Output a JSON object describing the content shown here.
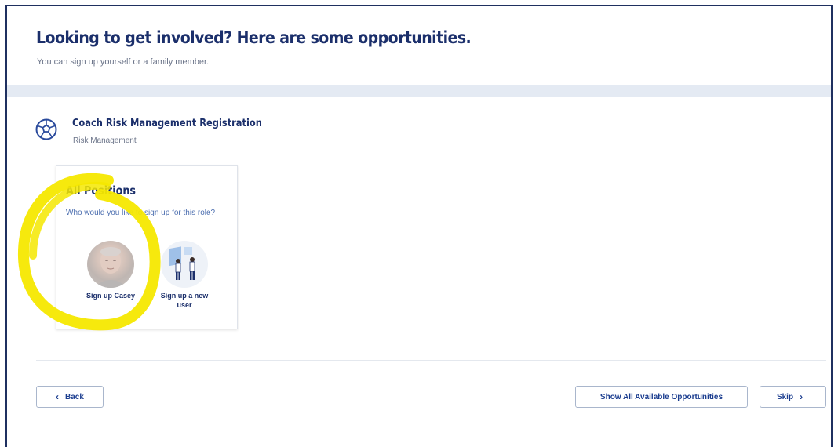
{
  "header": {
    "title": "Looking to get involved? Here are some opportunities.",
    "subtitle": "You can sign up yourself or a family member."
  },
  "opportunity": {
    "icon": "soccer-ball-icon",
    "title": "Coach Risk Management Registration",
    "category": "Risk Management"
  },
  "position_card": {
    "title": "All Positions",
    "question": "Who would you like to sign up for this role?",
    "options": [
      {
        "label": "Sign up Casey",
        "avatar": "casey-photo"
      },
      {
        "label": "Sign up a new user",
        "avatar": "new-user-illustration-icon"
      }
    ]
  },
  "footer": {
    "back_label": "Back",
    "back_icon": "chevron-left-icon",
    "show_all_label": "Show All Available Opportunities",
    "skip_label": "Skip",
    "skip_icon": "chevron-right-icon"
  },
  "annotation": {
    "type": "yellow-circle-highlight",
    "color": "#f5e800"
  },
  "colors": {
    "title": "#1b2f6b",
    "link": "#1b3d8f",
    "band": "#e4eaf3",
    "frame": "#1f3060"
  }
}
